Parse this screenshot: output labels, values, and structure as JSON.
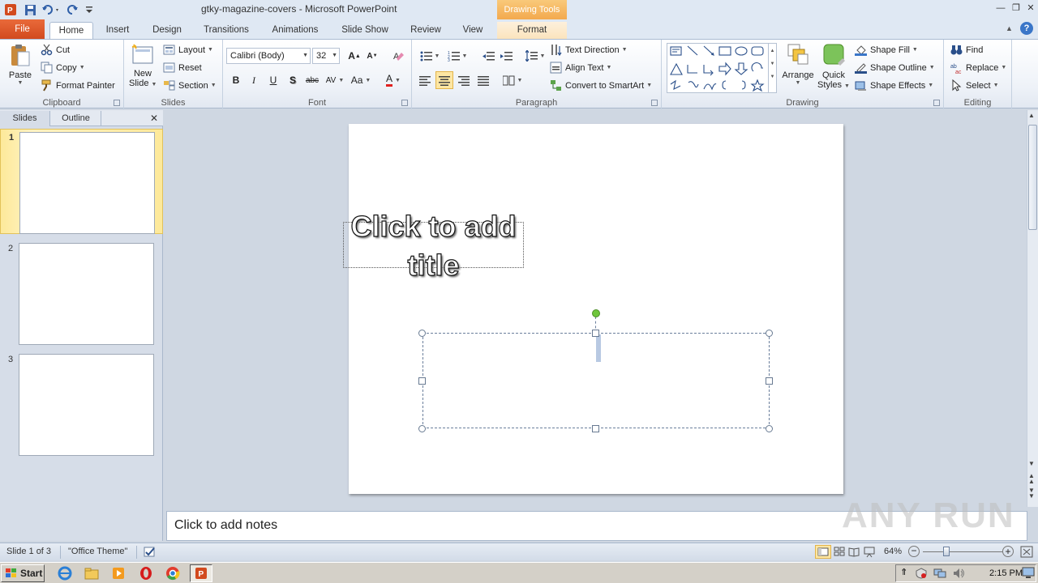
{
  "window": {
    "title": "gtky-magazine-covers - Microsoft PowerPoint",
    "contextual_tab_group": "Drawing Tools"
  },
  "tabs": {
    "file": "File",
    "home": "Home",
    "insert": "Insert",
    "design": "Design",
    "transitions": "Transitions",
    "animations": "Animations",
    "slide_show": "Slide Show",
    "review": "Review",
    "view": "View",
    "format": "Format"
  },
  "ribbon": {
    "clipboard": {
      "label": "Clipboard",
      "paste": "Paste",
      "cut": "Cut",
      "copy": "Copy",
      "format_painter": "Format Painter"
    },
    "slides": {
      "label": "Slides",
      "new_slide_1": "New",
      "new_slide_2": "Slide",
      "layout": "Layout",
      "reset": "Reset",
      "section": "Section"
    },
    "font": {
      "label": "Font",
      "font_name": "Calibri (Body)",
      "font_size": "32",
      "bold": "B",
      "italic": "I",
      "underline": "U",
      "shadow": "S",
      "strike": "abc",
      "spacing": "AV",
      "case": "Aa",
      "color": "A",
      "grow": "A",
      "shrink": "A"
    },
    "paragraph": {
      "label": "Paragraph",
      "text_direction": "Text Direction",
      "align_text": "Align Text",
      "smartart": "Convert to SmartArt"
    },
    "drawing": {
      "label": "Drawing",
      "arrange": "Arrange",
      "quick_styles_1": "Quick",
      "quick_styles_2": "Styles",
      "shape_fill": "Shape Fill",
      "shape_outline": "Shape Outline",
      "shape_effects": "Shape Effects"
    },
    "editing": {
      "label": "Editing",
      "find": "Find",
      "replace": "Replace",
      "select": "Select"
    }
  },
  "left_pane": {
    "tab_slides": "Slides",
    "tab_outline": "Outline",
    "slides": [
      {
        "num": "1"
      },
      {
        "num": "2"
      },
      {
        "num": "3"
      }
    ]
  },
  "slide": {
    "title_placeholder": "Click to add title"
  },
  "notes": {
    "placeholder": "Click to add notes"
  },
  "watermark": "ANY RUN",
  "status": {
    "slide_of": "Slide 1 of 3",
    "theme": "\"Office Theme\"",
    "zoom": "64%"
  },
  "taskbar": {
    "start": "Start",
    "clock": "2:15 PM"
  },
  "colors": {
    "accent_file": "#d24a1e",
    "drawing_tools": "#f3a94e",
    "rotation_handle": "#6fc63c"
  }
}
